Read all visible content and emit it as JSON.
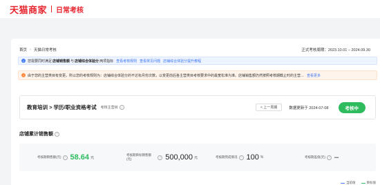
{
  "topbar": {
    "logo": "天猫商家",
    "app_name": "日常考核"
  },
  "breadcrumb": {
    "home": "首页",
    "current": "天猫日常考核"
  },
  "period_label": "正式考核周期：2023.10.01 – 2024.09.30",
  "notice_blue": {
    "prefix": "您需要同时满足",
    "metric1": "店铺销售额",
    "and": "与",
    "metric2": "店铺综合体验分",
    "suffix": "两项指标",
    "link1": "查看考核规则",
    "link2": "查看常见问题",
    "link3": "店铺综合体验分提升教程"
  },
  "notice_orange": {
    "text": "由于您的主营类目有变更，所以您的考核规则为：店铺综合体验分的不达标月份次数，以变更前后各主营类目考核要求中的最宽松准为准。店铺销售额仍然按照考核期截止时的主营…",
    "link": "查看更多"
  },
  "course": {
    "title": "教育培训 > 学历/职业资格考试",
    "cycle_label": "考核主营目",
    "prev_label": "< 上一周期",
    "updated": "数据更新于 2024-07-08",
    "status": "考核中"
  },
  "section": {
    "title": "店铺累计销售额"
  },
  "metrics": [
    {
      "label": "考核期销售额(元)",
      "value": "58.64",
      "unit": "元"
    },
    {
      "label": "考核期目标销售额(元)",
      "value": "500,000",
      "unit": "元"
    },
    {
      "label": "考核期完成情况",
      "value": "100",
      "unit": "%"
    },
    {
      "label": "考核期差值(元)",
      "value": "–",
      "unit": ""
    }
  ],
  "legend": {
    "item1": "当前值",
    "item2": "目标值"
  },
  "colors": {
    "brand": "#e8252e",
    "accent": "#2ebc5e",
    "link": "#3a74f2"
  }
}
